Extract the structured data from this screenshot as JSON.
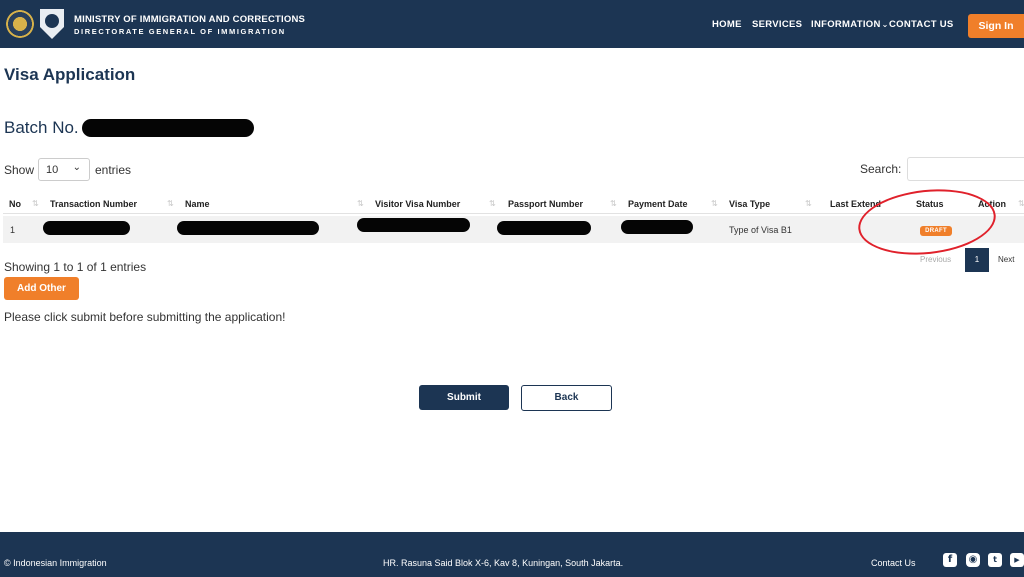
{
  "header": {
    "title": "MINISTRY OF IMMIGRATION AND CORRECTIONS",
    "subtitle": "DIRECTORATE GENERAL OF IMMIGRATION",
    "nav": [
      "HOME",
      "SERVICES",
      "INFORMATION",
      "CONTACT US"
    ],
    "signin_label": "Sign In"
  },
  "page": {
    "title": "Visa Application",
    "batch_label": "Batch No."
  },
  "table_controls": {
    "show_label": "Show",
    "entries_value": "10",
    "entries_label": "entries",
    "search_label": "Search:"
  },
  "table": {
    "columns": [
      "No",
      "Transaction Number",
      "Name",
      "Visitor Visa Number",
      "Passport Number",
      "Payment Date",
      "Visa Type",
      "Last Extend",
      "Status",
      "Action"
    ],
    "rows": [
      {
        "no": "1",
        "visa_type": "Type of Visa B1",
        "status": "DRAFT"
      }
    ]
  },
  "pagination": {
    "info": "Showing 1 to 1 of 1 entries",
    "previous": "Previous",
    "current": "1",
    "next": "Next"
  },
  "actions": {
    "add_other": "Add Other",
    "notice": "Please click submit before submitting the application!",
    "submit": "Submit",
    "back": "Back"
  },
  "footer": {
    "copyright": "© Indonesian Immigration",
    "address": "HR. Rasuna Said Blok X-6, Kav 8, Kuningan, South Jakarta.",
    "contact": "Contact Us",
    "social_icons": [
      "facebook-icon",
      "instagram-icon",
      "twitter-icon",
      "youtube-icon"
    ]
  },
  "colors": {
    "navy": "#1c3553",
    "orange": "#f07f2a",
    "annotation_red": "#e0212b"
  }
}
